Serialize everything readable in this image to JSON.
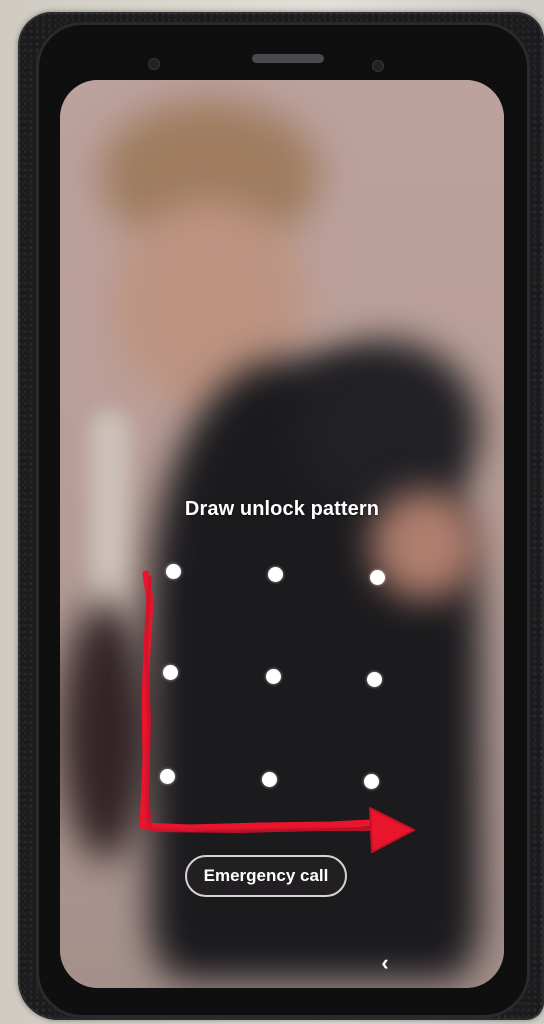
{
  "lock_screen": {
    "prompt": "Draw unlock pattern",
    "pattern_dots": [
      {
        "row": 1,
        "col": 1
      },
      {
        "row": 1,
        "col": 2
      },
      {
        "row": 1,
        "col": 3
      },
      {
        "row": 2,
        "col": 1
      },
      {
        "row": 2,
        "col": 2
      },
      {
        "row": 2,
        "col": 3
      },
      {
        "row": 3,
        "col": 1
      },
      {
        "row": 3,
        "col": 2
      },
      {
        "row": 3,
        "col": 3
      }
    ],
    "emergency_call_label": "Emergency call",
    "back_icon": "chevron-left-icon"
  },
  "annotation": {
    "type": "L-shaped arrow",
    "color": "#e8152c"
  },
  "colors": {
    "dot": "#ffffff",
    "text": "#ffffff"
  }
}
